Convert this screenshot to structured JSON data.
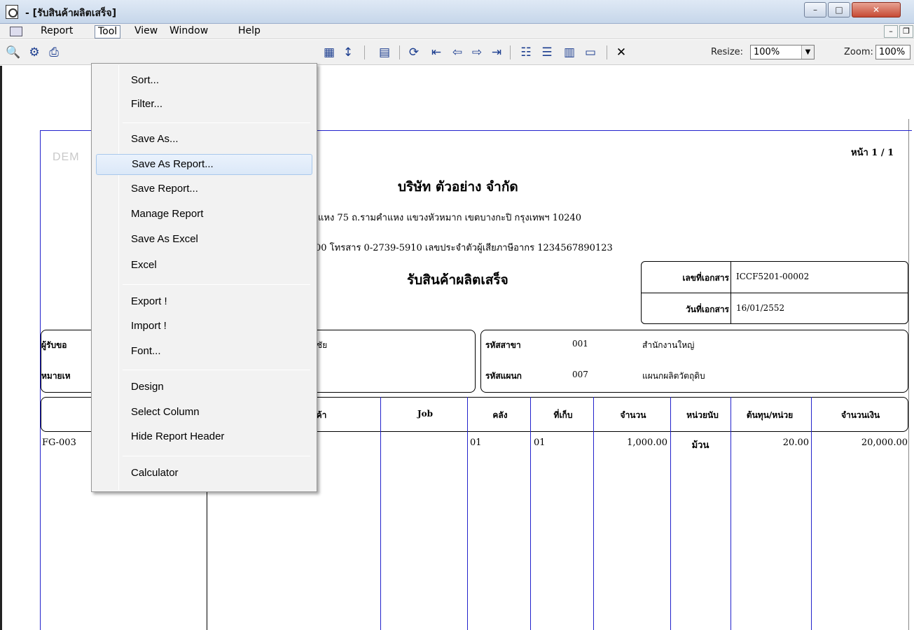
{
  "window": {
    "title": "- [รับสินค้าผลิตเสร็จ]",
    "minimize": "–",
    "maximize": "□",
    "close": "✕"
  },
  "menubar": {
    "items": [
      "Report",
      "Tool",
      "View",
      "Window",
      "Help"
    ],
    "mdi_minimize": "–",
    "mdi_restore": "❐"
  },
  "toolbar": {
    "resize_label": "Resize:",
    "resize_value": "100%",
    "zoom_label": "Zoom:",
    "zoom_value": "100%"
  },
  "tool_menu": {
    "items": [
      "Sort...",
      "Filter...",
      "Save As...",
      "Save As Report...",
      "Save Report...",
      "Manage Report",
      "Save As Excel",
      "Excel",
      "Export !",
      "Import !",
      "Font...",
      "Design",
      "Select Column",
      "Hide Report Header",
      "Calculator"
    ],
    "highlighted": "Save As Report..."
  },
  "report": {
    "watermark": "DEM",
    "page": "หน้า 1 / 1",
    "company_name": "บริษัท ตัวอย่าง จำกัด",
    "address": "คำแหง 75 ถ.รามคำแหง แขวงหัวหมาก เขตบางกะปิ กรุงเทพฯ 10240",
    "phone": "00  โทรสาร 0-2739-5910  เลขประจำตัวผู้เสียภาษีอากร 1234567890123",
    "title": "รับสินค้าผลิตเสร็จ",
    "doc_no_label": "เลขที่เอกสาร",
    "doc_no": "ICCF5201-00002",
    "doc_date_label": "วันที่เอกสาร",
    "doc_date": "16/01/2552",
    "receiver_label": "ผู้รับขอ",
    "note_label": "หมายเห",
    "receiver_value": "ชัย",
    "branch_label": "รหัสสาขา",
    "branch_code": "001",
    "branch_name": "สำนักงานใหญ่",
    "dept_label": "รหัสแผนก",
    "dept_code": "007",
    "dept_name": "แผนกผลิตวัตถุดิบ",
    "columns": [
      "ค้า",
      "Job",
      "คลัง",
      "ที่เก็บ",
      "จำนวน",
      "หน่วยนับ",
      "ต้นทุน/หน่วย",
      "จำนวนเงิน"
    ],
    "rows": [
      {
        "code": "FG-003",
        "warehouse": "01",
        "location": "01",
        "qty": "1,000.00",
        "unit": "ม้วน",
        "cost": "20.00",
        "amount": "20,000.00"
      }
    ]
  }
}
